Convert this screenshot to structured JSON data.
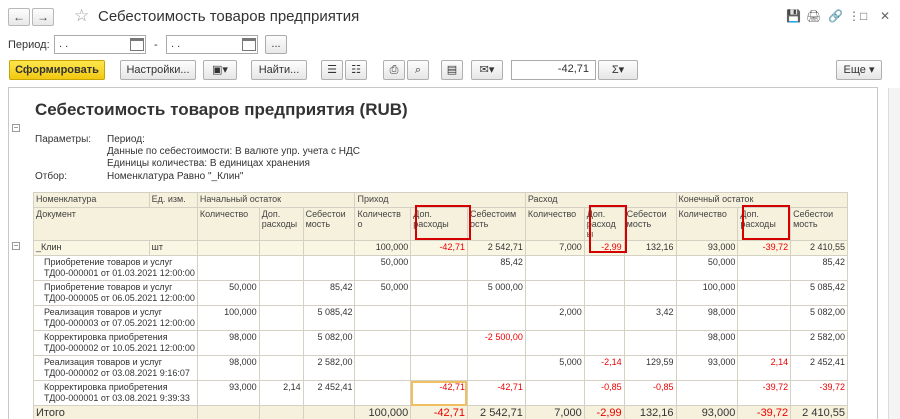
{
  "window": {
    "title": "Себестоимость товаров предприятия",
    "back": "←",
    "forward": "→",
    "star": "☆",
    "icons": [
      "💾",
      "🖨",
      "🔗",
      "⋮",
      "□",
      "✕"
    ]
  },
  "period": {
    "label": "Период:",
    "from": ". .",
    "to": ". .",
    "dash": "-",
    "more": "..."
  },
  "toolbar": {
    "generate": "Сформировать",
    "settings": "Настройки...",
    "find": "Найти...",
    "sum_value": "-42,71",
    "sum_sign": "Σ",
    "more": "Еще"
  },
  "report": {
    "title": "Себестоимость товаров предприятия (RUB)",
    "params_label": "Параметры:",
    "param_period": "Период:",
    "param_data": "Данные по себестоимости: В валюте упр. учета с НДС",
    "param_units": "Единицы количества: В единицах хранения",
    "filter_label": "Отбор:",
    "filter_value": "Номенклатура Равно \"_Клин\""
  },
  "headers": {
    "nom": "Номенклатура",
    "unit": "Ед. изм.",
    "doc": "Документ",
    "start": "Начальный остаток",
    "income": "Приход",
    "expense": "Расход",
    "end": "Конечный остаток",
    "qty": "Количество",
    "qty_wrap": "Количеств о",
    "add": "Доп. расходы",
    "add_wrap": "Доп. расход ы",
    "cost": "Себестои мость",
    "cost2": "Себестоим ость"
  },
  "group_row": {
    "name": "_Клин",
    "unit": "шт",
    "start_qty": "",
    "start_add": "",
    "start_cost": "",
    "in_qty": "100,000",
    "in_add": "-42,71",
    "in_cost": "2 542,71",
    "out_qty": "7,000",
    "out_add": "-2,99",
    "out_cost": "132,16",
    "end_qty": "93,000",
    "end_add": "-39,72",
    "end_cost": "2 410,55"
  },
  "rows": [
    {
      "doc1": "Приобретение товаров и услуг",
      "doc2": "ТД00-000001 от 01.03.2021 12:00:00",
      "c": [
        "",
        "",
        "",
        "50,000",
        "",
        "85,42",
        "",
        "",
        "",
        "50,000",
        "",
        "85,42"
      ]
    },
    {
      "doc1": "Приобретение товаров и услуг",
      "doc2": "ТД00-000005 от 06.05.2021 12:00:00",
      "c": [
        "50,000",
        "",
        "85,42",
        "50,000",
        "",
        "5 000,00",
        "",
        "",
        "",
        "100,000",
        "",
        "5 085,42"
      ]
    },
    {
      "doc1": "Реализация товаров и услуг",
      "doc2": "ТД00-000003 от 07.05.2021 12:00:00",
      "c": [
        "100,000",
        "",
        "5 085,42",
        "",
        "",
        "",
        "2,000",
        "",
        "3,42",
        "98,000",
        "",
        "5 082,00"
      ]
    },
    {
      "doc1": "Корректировка приобретения",
      "doc2": "ТД00-000002 от 10.05.2021 12:00:00",
      "c": [
        "98,000",
        "",
        "5 082,00",
        "",
        "",
        "-2 500,00",
        "",
        "",
        "",
        "98,000",
        "",
        "2 582,00"
      ]
    },
    {
      "doc1": "Реализация товаров и услуг",
      "doc2": "ТД00-000002 от 03.08.2021 9:16:07",
      "c": [
        "98,000",
        "",
        "2 582,00",
        "",
        "",
        "",
        "5,000",
        "-2,14",
        "129,59",
        "93,000",
        "2,14",
        "2 452,41"
      ]
    },
    {
      "doc1": "Корректировка приобретения",
      "doc2": "ТД00-000001 от 03.08.2021 9:39:33",
      "c": [
        "93,000",
        "2,14",
        "2 452,41",
        "",
        "-42,71",
        "-42,71",
        "",
        "-0,85",
        "-0,85",
        "",
        "-39,72",
        "-39,72"
      ]
    }
  ],
  "total": {
    "label": "Итого",
    "c": [
      "",
      "",
      "",
      "100,000",
      "-42,71",
      "2 542,71",
      "7,000",
      "-2,99",
      "132,16",
      "93,000",
      "-39,72",
      "2 410,55"
    ]
  }
}
